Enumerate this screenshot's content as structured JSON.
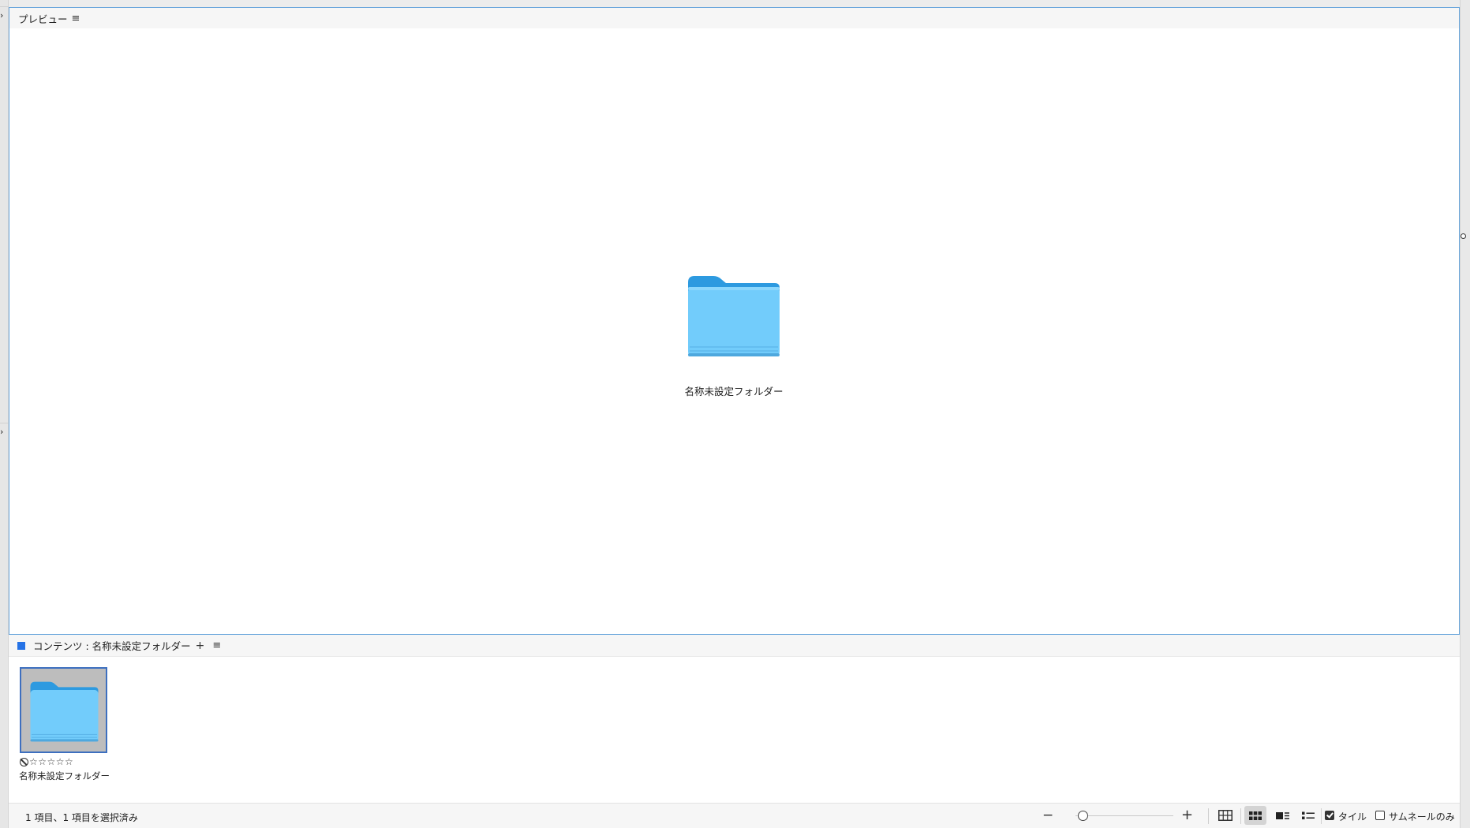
{
  "preview": {
    "title": "プレビュー",
    "menu_glyph": "≡",
    "folder_label": "名称未設定フォルダー"
  },
  "content": {
    "title": "コンテンツ : 名称未設定フォルダー",
    "plus_glyph": "+",
    "menu_glyph": "≡",
    "tag_color": "#2673e6",
    "items": [
      {
        "name": "名称未設定フォルダー",
        "rating_stars": "☆☆☆☆☆",
        "selected": true
      }
    ]
  },
  "statusbar": {
    "status_text": "1 項目、1 項目を選択済み",
    "zoom_minus": "−",
    "zoom_plus": "+",
    "zoom_level": 0.05,
    "view_modes": [
      "grid",
      "tiles",
      "thumbnail-details",
      "list"
    ],
    "active_view": "tiles",
    "tile_label": "タイル",
    "tile_checked": true,
    "thumbnail_only_label": "サムネールのみ",
    "thumbnail_only_checked": false
  },
  "colors": {
    "panel_border": "#6aa6dc",
    "selection_border": "#3d6fbf",
    "folder_body": "#72ccfb",
    "folder_back": "#2d9ae0"
  }
}
